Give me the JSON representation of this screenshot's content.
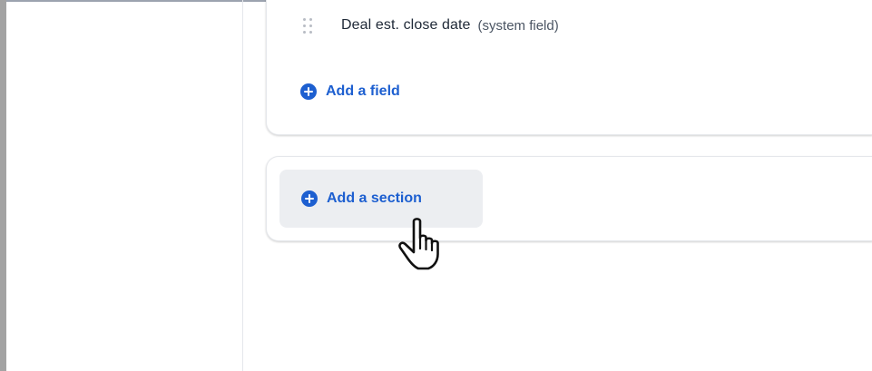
{
  "fields_card": {
    "field_row": {
      "icon": "drag-handle-icon",
      "name": "Deal est. close date",
      "note": "(system field)"
    },
    "add_field": {
      "icon": "plus-circle-icon",
      "label": "Add a field"
    }
  },
  "section_card": {
    "add_section": {
      "icon": "plus-circle-icon",
      "label": "Add a section"
    }
  },
  "pointer": {
    "icon": "hand-pointer-cursor-icon"
  },
  "colors": {
    "accent": "#1d5fd0",
    "button_hover_bg": "#eceef1",
    "text": "#1f2937",
    "muted_text": "#4b5563",
    "border": "#e5e7eb"
  }
}
